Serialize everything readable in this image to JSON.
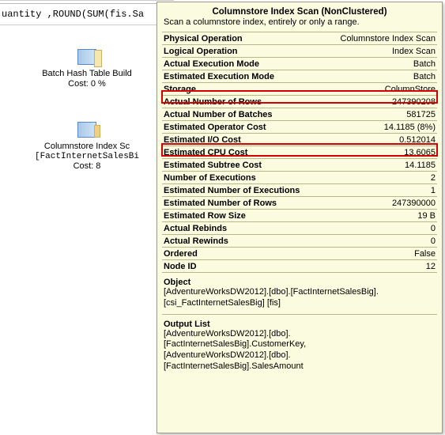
{
  "sql_snippet": "uantity ,ROUND(SUM(fis.Sa",
  "ops": {
    "hash": {
      "label": "Batch Hash Table Build",
      "cost": "Cost: 0 %"
    },
    "scan": {
      "label": "Columnstore Index Sc",
      "sub": "[FactInternetSalesBi",
      "cost": "Cost: 8"
    }
  },
  "tooltip": {
    "title": "Columnstore Index Scan (NonClustered)",
    "desc": "Scan a columnstore index, entirely or only a range.",
    "rows": [
      {
        "k": "Physical Operation",
        "v": "Columnstore Index Scan",
        "bold": true
      },
      {
        "k": "Logical Operation",
        "v": "Index Scan",
        "bold": true
      },
      {
        "k": "Actual Execution Mode",
        "v": "Batch",
        "bold": true,
        "hl": true
      },
      {
        "k": "Estimated Execution Mode",
        "v": "Batch",
        "bold": true
      },
      {
        "k": "Storage",
        "v": "ColumnStore",
        "bold": true
      },
      {
        "k": "Actual Number of Rows",
        "v": "247390208",
        "bold": true
      },
      {
        "k": "Actual Number of Batches",
        "v": "581725",
        "bold": true,
        "hl": true
      },
      {
        "k": "Estimated Operator Cost",
        "v": "14.1185 (8%)",
        "bold": true
      },
      {
        "k": "Estimated I/O Cost",
        "v": "0.512014",
        "bold": true
      },
      {
        "k": "Estimated CPU Cost",
        "v": "13.6065",
        "bold": true
      },
      {
        "k": "Estimated Subtree Cost",
        "v": "14.1185",
        "bold": true
      },
      {
        "k": "Number of Executions",
        "v": "2",
        "bold": true
      },
      {
        "k": "Estimated Number of Executions",
        "v": "1",
        "bold": true
      },
      {
        "k": "Estimated Number of Rows",
        "v": "247390000",
        "bold": true
      },
      {
        "k": "Estimated Row Size",
        "v": "19 B",
        "bold": true
      },
      {
        "k": "Actual Rebinds",
        "v": "0",
        "bold": true
      },
      {
        "k": "Actual Rewinds",
        "v": "0",
        "bold": true
      },
      {
        "k": "Ordered",
        "v": "False",
        "bold": true
      },
      {
        "k": "Node ID",
        "v": "12",
        "bold": true
      }
    ],
    "object_heading": "Object",
    "object_lines": [
      "[AdventureWorksDW2012].[dbo].[FactInternetSalesBig].",
      "[csi_FactInternetSalesBig] [fis]"
    ],
    "output_heading": "Output List",
    "output_lines": [
      "[AdventureWorksDW2012].[dbo].",
      "[FactInternetSalesBig].CustomerKey,",
      "[AdventureWorksDW2012].[dbo].",
      "[FactInternetSalesBig].SalesAmount"
    ]
  }
}
